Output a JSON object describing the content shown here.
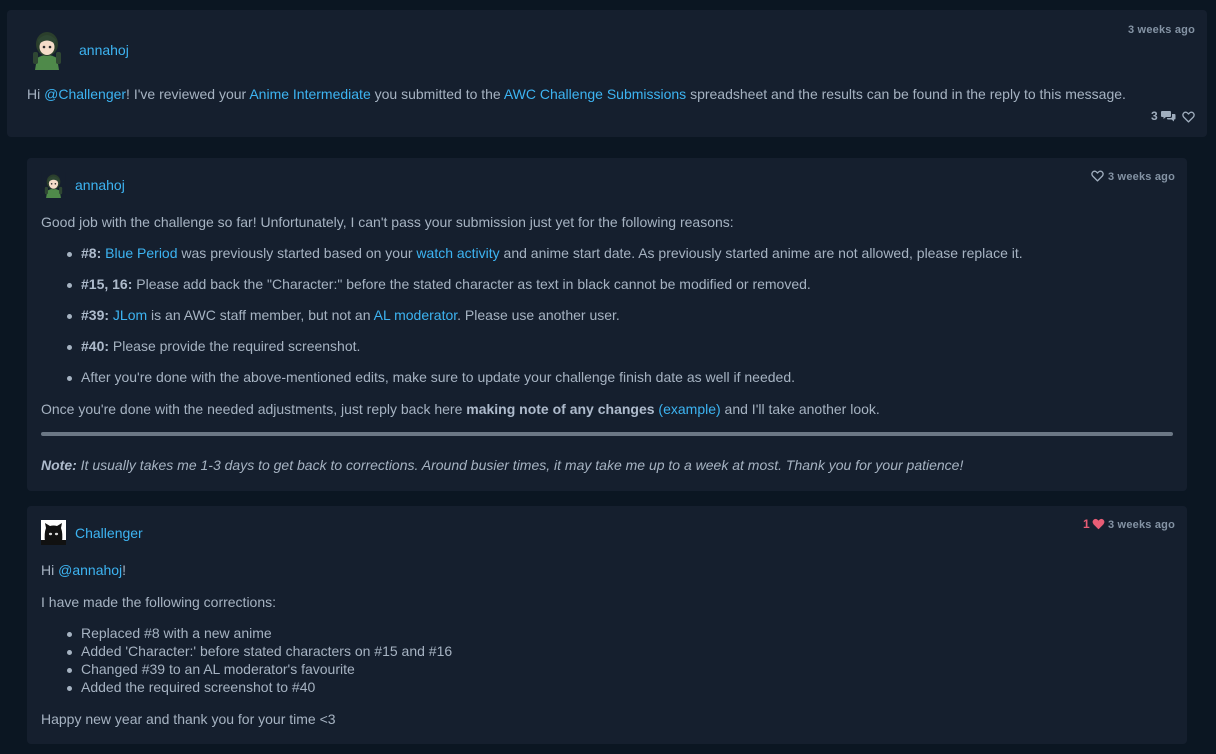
{
  "activity": {
    "author": "annahoj",
    "time": "3 weeks ago",
    "text": {
      "hi": "Hi ",
      "mention": "@Challenger",
      "p1": "! I've reviewed your ",
      "link1": "Anime Intermediate",
      "p2": " you submitted to the ",
      "link2": "AWC Challenge Submissions",
      "p3": " spreadsheet and the results can be found in the reply to this message."
    },
    "reply_count": "3"
  },
  "reply1": {
    "author": "annahoj",
    "time": "3 weeks ago",
    "intro": "Good job with the challenge so far! Unfortunately, I can't pass your submission just yet for the following reasons:",
    "bullets": {
      "b1": {
        "bold": "#8:",
        "link1": "Blue Period",
        "t1": " was previously started based on your ",
        "link2": "watch activity",
        "t2": " and anime start date. As previously started anime are not allowed, please replace it."
      },
      "b2": {
        "bold": "#15, 16:",
        "t1": " Please add back the \"Character:\" before the stated character as text in black cannot be modified or removed."
      },
      "b3": {
        "bold": "#39:",
        "link1": "JLom",
        "t1": " is an AWC staff member, but not an ",
        "link2": "AL moderator",
        "t2": ". Please use another user."
      },
      "b4": {
        "bold": "#40:",
        "t1": " Please provide the required screenshot."
      },
      "b5": {
        "t1": "After you're done with the above-mentioned edits, make sure to update your challenge finish date as well if needed."
      }
    },
    "outro": {
      "t1": "Once you're done with the needed adjustments, just reply back here ",
      "bold": "making note of any changes",
      "link": "(example)",
      "t2": " and I'll take another look."
    },
    "note": {
      "bold": "Note:",
      "t1": " It usually takes me 1-3 days to get back to corrections. Around busier times, it may take me up to a week at most. Thank you for your patience!"
    }
  },
  "reply2": {
    "author": "Challenger",
    "time": "3 weeks ago",
    "like_count": "1",
    "greeting": {
      "t1": "Hi ",
      "mention": "@annahoj",
      "t2": "!"
    },
    "intro": "I have made the following corrections:",
    "items": [
      "Replaced #8 with a new anime",
      "Added 'Character:' before stated characters on #15 and #16",
      "Changed #39 to an AL moderator's favourite",
      "Added the required screenshot to #40"
    ],
    "closing": "Happy new year and thank you for your time <3"
  },
  "colors": {
    "background": "#0b1622",
    "card": "#151f2e",
    "link": "#3db4f2",
    "like": "#e85d75"
  },
  "icons": {
    "replies": "speech-bubbles-icon",
    "like": "heart-icon"
  }
}
